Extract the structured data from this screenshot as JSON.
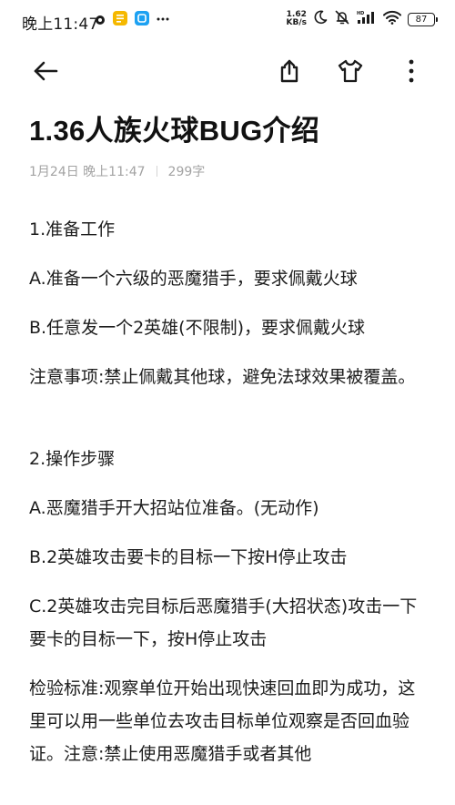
{
  "status_bar": {
    "time": "晚上11:47",
    "net_speed_value": "1.62",
    "net_speed_unit": "KB/s",
    "battery": "87"
  },
  "toolbar": {
    "back_icon": "arrow-left-icon",
    "share_icon": "share-icon",
    "theme_icon": "tshirt-icon",
    "more_icon": "more-vertical-icon"
  },
  "article": {
    "title": "1.36人族火球BUG介绍",
    "date": "1月24日 晚上11:47",
    "word_count": "299字",
    "paragraphs": [
      "1.准备工作",
      " A.准备一个六级的恶魔猎手，要求佩戴火球",
      " B.任意发一个2英雄(不限制)，要求佩戴火球",
      "注意事项:禁止佩戴其他球，避免法球效果被覆盖。",
      "2.操作步骤",
      " A.恶魔猎手开大招站位准备。(无动作)",
      " B.2英雄攻击要卡的目标一下按H停止攻击",
      " C.2英雄攻击完目标后恶魔猎手(大招状态)攻击一下要卡的目标一下，按H停止攻击",
      "检验标准:观察单位开始出现快速回血即为成功，这里可以用一些单位去攻击目标单位观察是否回血验证。注意:禁止使用恶魔猎手或者其他"
    ]
  },
  "colors": {
    "text": "#1c1c1c",
    "meta": "#a3a3a3",
    "status_yellow": "#f5b800",
    "status_blue": "#1da1f2"
  }
}
